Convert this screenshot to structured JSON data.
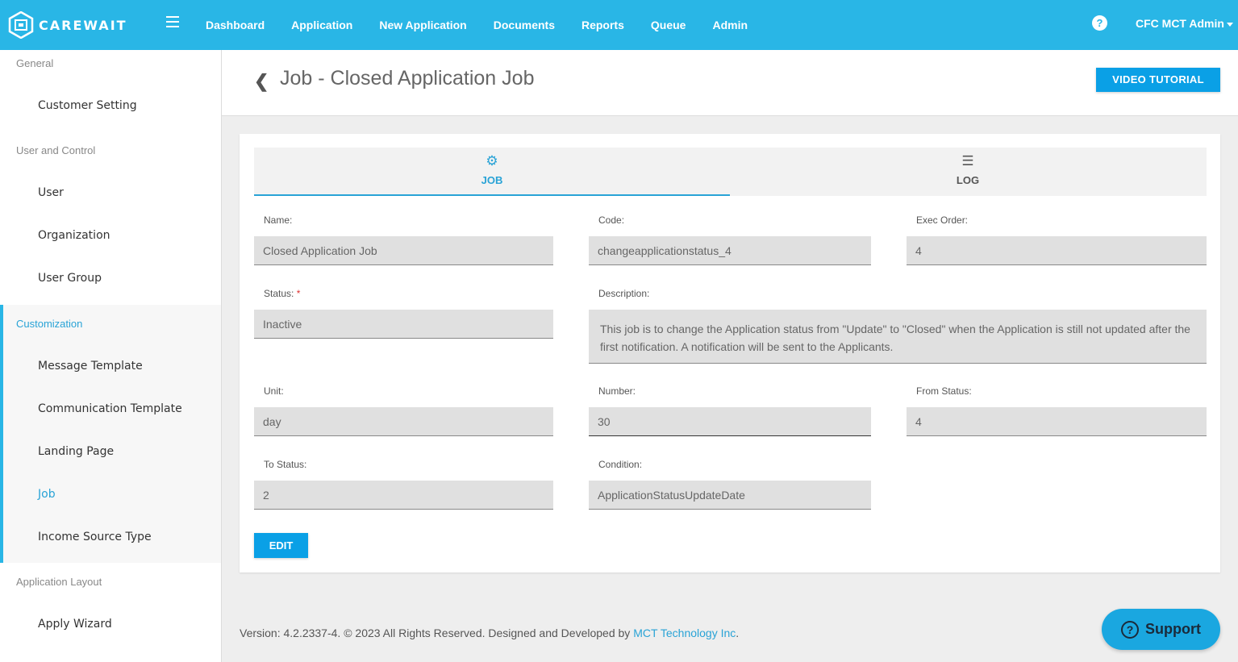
{
  "app": {
    "logo_text": "CAREWAIT",
    "nav": [
      "Dashboard",
      "Application",
      "New Application",
      "Documents",
      "Reports",
      "Queue",
      "Admin"
    ],
    "help_glyph": "?",
    "user": "CFC MCT Admin"
  },
  "sidebar": {
    "sections": [
      {
        "heading": "General",
        "items": [
          "Customer Setting"
        ]
      },
      {
        "heading": "User and Control",
        "items": [
          "User",
          "Organization",
          "User Group"
        ]
      },
      {
        "heading": "Customization",
        "items": [
          "Message Template",
          "Communication Template",
          "Landing Page",
          "Job",
          "Income Source Type"
        ]
      },
      {
        "heading": "Application Layout",
        "items": [
          "Apply Wizard"
        ]
      }
    ],
    "active_section": "Customization",
    "active_item": "Job"
  },
  "header": {
    "back_glyph": "❮",
    "title": "Job - Closed Application Job",
    "video_button": "VIDEO TUTORIAL"
  },
  "tabs": {
    "job": {
      "label": "JOB",
      "icon": "gear-icon",
      "glyph": "⚙"
    },
    "log": {
      "label": "LOG",
      "icon": "list-icon",
      "glyph": "☰"
    }
  },
  "form": {
    "name": {
      "label": "Name:",
      "value": "Closed Application Job"
    },
    "code": {
      "label": "Code:",
      "value": "changeapplicationstatus_4"
    },
    "exec_order": {
      "label": "Exec Order:",
      "value": "4"
    },
    "status": {
      "label": "Status:",
      "required_mark": "*",
      "value": "Inactive"
    },
    "description": {
      "label": "Description:",
      "value": "This job is to change the Application status from \"Update\" to \"Closed\" when the Application is still not updated after the first notification. A notification will be sent to the Applicants."
    },
    "unit": {
      "label": "Unit:",
      "value": "day"
    },
    "number": {
      "label": "Number:",
      "value": "30"
    },
    "from_status": {
      "label": "From Status:",
      "value": "4"
    },
    "to_status": {
      "label": "To Status:",
      "value": "2"
    },
    "condition": {
      "label": "Condition:",
      "value": "ApplicationStatusUpdateDate"
    },
    "edit_button": "EDIT"
  },
  "footer": {
    "text": "Version: 4.2.2337-4. © 2023 All Rights Reserved. Designed and Developed by ",
    "link": "MCT Technology Inc",
    "end": "."
  },
  "support": {
    "label": "Support",
    "glyph": "?"
  },
  "colors": {
    "primary": "#29b6e6",
    "button": "#0aa0e6",
    "active": "#29a3d6"
  }
}
